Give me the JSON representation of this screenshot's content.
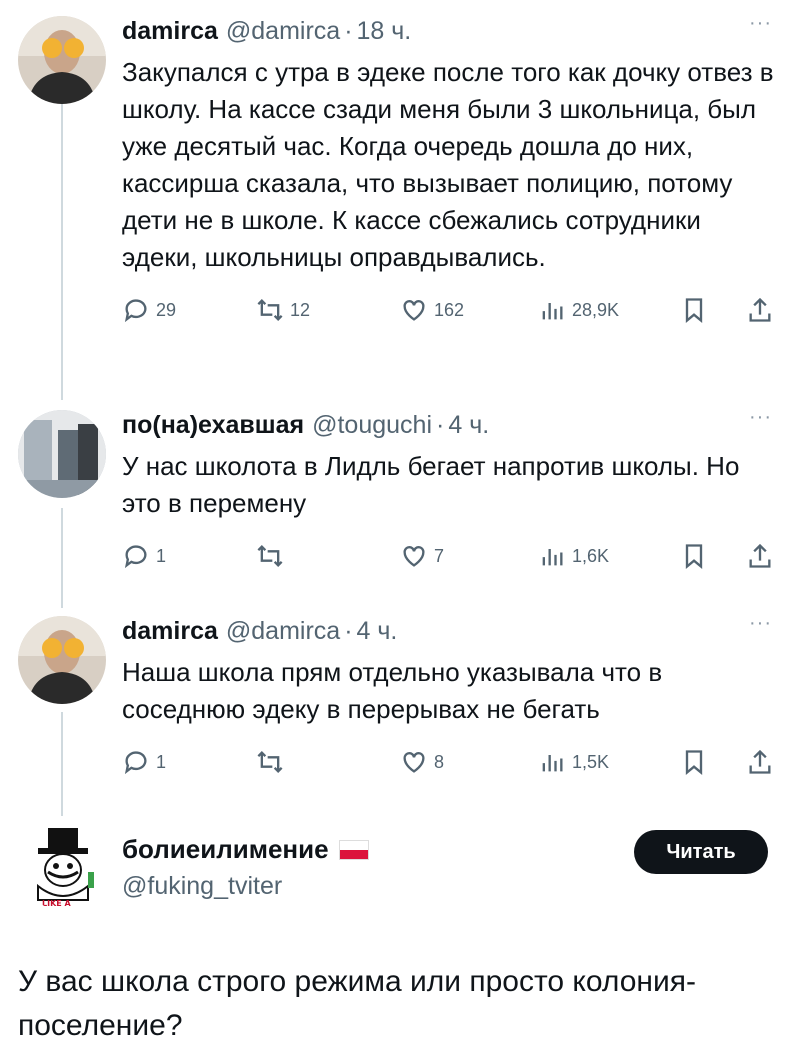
{
  "tweets": [
    {
      "name": "damirca",
      "handle": "@damirca",
      "time": "18 ч.",
      "text": "Закупался с утра в эдеке после того как дочку отвез в школу. На кассе сзади меня были 3 школьница, был уже десятый час. Когда очередь дошла до них, кассирша сказала, что вызывает полицию, потому дети не в школе. К кассе сбежались сотрудники эдеки, школьницы оправдывались.",
      "replies": "29",
      "retweets": "12",
      "likes": "162",
      "views": "28,9K"
    },
    {
      "name": "по(на)ехавшая",
      "handle": "@touguchi",
      "time": "4 ч.",
      "text": "У нас школота в Лидль бегает напротив школы. Но это в перемену",
      "replies": "1",
      "retweets": "",
      "likes": "7",
      "views": "1,6K"
    },
    {
      "name": "damirca",
      "handle": "@damirca",
      "time": "4 ч.",
      "text": "Наша школа прям отдельно указывала что в соседнюю эдеку в перерывах не бегать",
      "replies": "1",
      "retweets": "",
      "likes": "8",
      "views": "1,5K"
    }
  ],
  "main": {
    "name": "болиеилимение",
    "handle": "@fuking_tviter",
    "follow_label": "Читать",
    "text": "У вас школа строго режима или просто колония-поселение?",
    "avatar_badge": "LIKE A"
  },
  "more_label": "···",
  "dot": "·"
}
